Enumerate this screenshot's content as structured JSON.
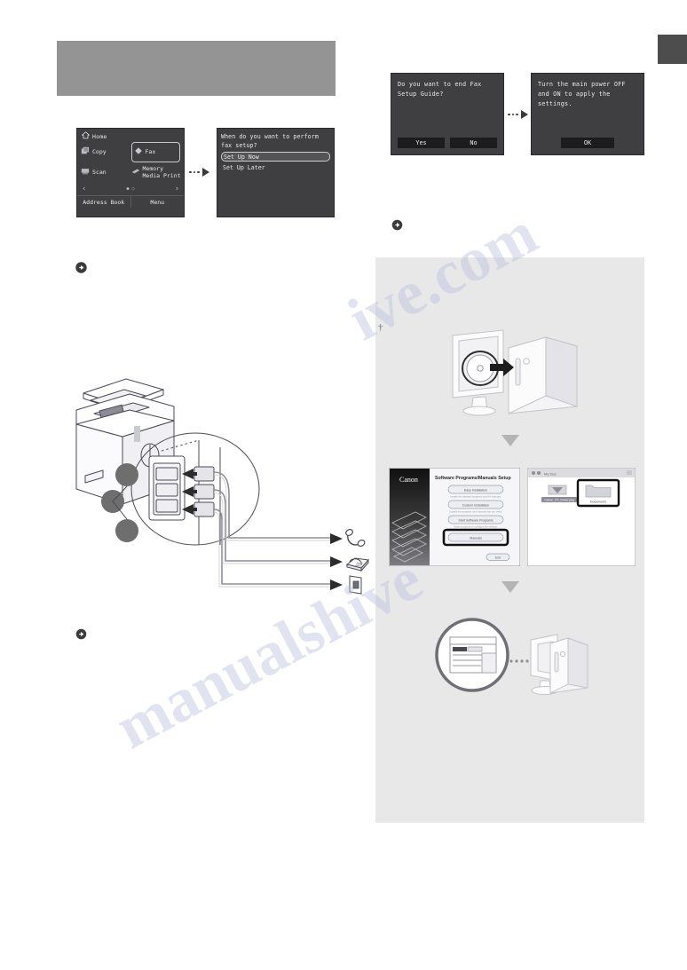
{
  "page": {
    "tab_label": "",
    "title_band_label": "",
    "watermark_left": "manualshive",
    "watermark_right": "ive.com"
  },
  "icons": {
    "home": "home-icon",
    "copy": "copy-icon",
    "fax": "fax-icon",
    "scan": "scan-icon",
    "memory_media": "usb-media-icon",
    "prev": "‹",
    "next": "›",
    "info": "ℹ",
    "reference": "circled-right-arrow-icon",
    "dagger": "†"
  },
  "home_screen": {
    "header": "Home",
    "tiles": [
      {
        "label": "Copy",
        "icon": "copy-icon",
        "selected": false
      },
      {
        "label": "Fax",
        "icon": "fax-icon",
        "selected": true
      },
      {
        "label": "Scan",
        "icon": "scan-icon",
        "selected": false
      },
      {
        "label": "Memory\nMedia Print",
        "icon": "usb-media-icon",
        "selected": false
      }
    ],
    "footer": [
      {
        "label": "Address Book"
      },
      {
        "label": "Menu"
      }
    ]
  },
  "fax_setup_screen": {
    "question": "When do you want to perform fax setup?",
    "options": [
      {
        "label": "Set Up Now",
        "selected": true
      },
      {
        "label": "Set Up Later",
        "selected": false
      }
    ]
  },
  "end_guide_screen": {
    "question": "Do you want to end Fax Setup Guide?",
    "buttons": [
      {
        "label": "Yes"
      },
      {
        "label": "No"
      }
    ]
  },
  "power_cycle_screen": {
    "message": "Turn the main power OFF and ON to apply the settings.",
    "buttons": [
      {
        "label": "OK"
      }
    ]
  },
  "printer_diagram": {
    "callouts": [
      "",
      "",
      ""
    ],
    "targets": [
      {
        "name": "handset-icon"
      },
      {
        "name": "telephone-icon"
      },
      {
        "name": "wall-jack-icon"
      }
    ]
  },
  "install_panel": {
    "step_cd": "insert-cd-into-computer",
    "setup_dialog": {
      "brand": "Canon",
      "title": "Software Programs/Manuals Setup",
      "buttons": [
        {
          "label": "Easy Installation",
          "note": "Installs the standard programs and the manuals."
        },
        {
          "label": "Custom Installation",
          "note": "Installs the programs and manuals that you need."
        },
        {
          "label": "Start Software Programs",
          "note": "Starts programs to configure the settings."
        },
        {
          "label": "Manuals",
          "highlighted": true
        }
      ],
      "exit_label": "Exit"
    },
    "mac_window": {
      "title": "My Disc",
      "items": [
        {
          "label": "Canon_XX_Driver.pkg",
          "icon": "installer-icon",
          "highlighted": false
        },
        {
          "label": "Documents",
          "icon": "folder-icon",
          "highlighted": true
        }
      ]
    },
    "result": "manual-displayed-on-computer"
  }
}
